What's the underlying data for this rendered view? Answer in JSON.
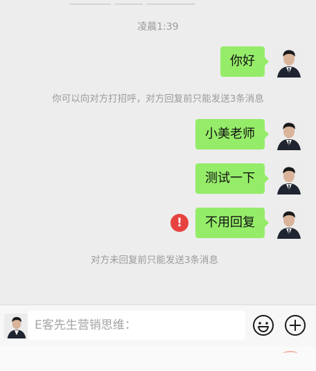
{
  "chat": {
    "timestamp": "凌晨1:39",
    "messages": [
      {
        "text": "你好"
      },
      {
        "text": "小美老师"
      },
      {
        "text": "测试一下"
      },
      {
        "text": "不用回复",
        "failed": true,
        "failed_icon_text": "!"
      }
    ],
    "system_notices": [
      "你可以向对方打招呼，对方回复前只能发送3条消息",
      "对方未回复前只能发送3条消息"
    ]
  },
  "input_bar": {
    "placeholder": "E客先生营销思维：",
    "value": "",
    "emoji_icon": "emoji-icon",
    "plus_icon": "plus-circle-icon"
  },
  "colors": {
    "bubble": "#95ec69",
    "background": "#ededed",
    "error": "#e64340"
  }
}
